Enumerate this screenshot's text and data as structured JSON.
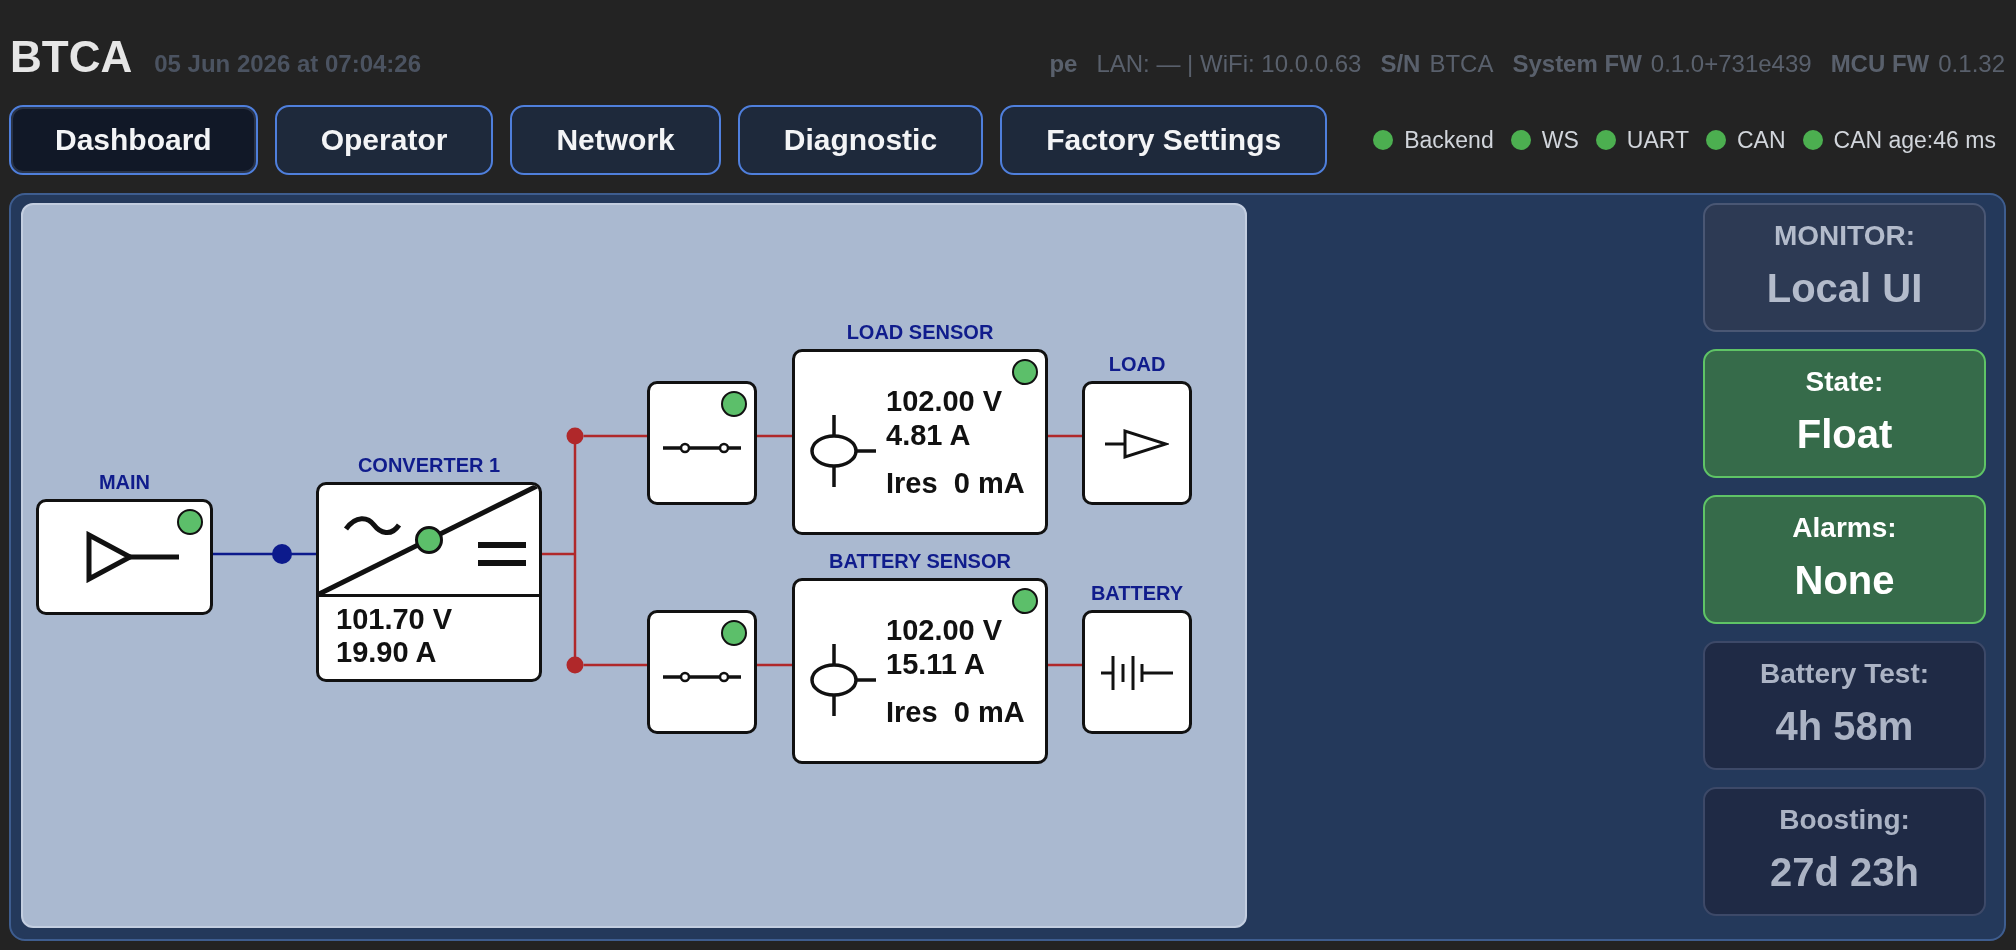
{
  "header": {
    "title": "BTCA",
    "timestamp": "05 Jun 2026 at 07:04:26",
    "info": [
      {
        "label": "pe"
      },
      {
        "value": "LAN: — | WiFi: 10.0.0.63"
      },
      {
        "label": "S/N",
        "value": "BTCA"
      },
      {
        "label": "System FW",
        "value": "0.1.0+731e439"
      },
      {
        "label": "MCU FW",
        "value": "0.1.32"
      }
    ]
  },
  "tabs": [
    {
      "label": "Dashboard",
      "selected": true
    },
    {
      "label": "Operator",
      "selected": false
    },
    {
      "label": "Network",
      "selected": false
    },
    {
      "label": "Diagnostic",
      "selected": false
    },
    {
      "label": "Factory Settings",
      "selected": false
    }
  ],
  "status": [
    {
      "label": "Backend",
      "ok": true
    },
    {
      "label": "WS",
      "ok": true
    },
    {
      "label": "UART",
      "ok": true
    },
    {
      "label": "CAN",
      "ok": true
    },
    {
      "label": "CAN age:46 ms",
      "ok": true
    }
  ],
  "diagram": {
    "main": {
      "label": "MAIN",
      "ok": true
    },
    "converter": {
      "label": "CONVERTER 1",
      "ok": true,
      "voltage": "101.70 V",
      "current": "19.90 A"
    },
    "branches": [
      {
        "breaker": {
          "ok": true
        },
        "sensor": {
          "label": "LOAD SENSOR",
          "ok": true,
          "voltage": "102.00 V",
          "current": "4.81 A",
          "residual": "Ires  0 mA"
        },
        "endpoint": {
          "kind": "load",
          "label": "LOAD"
        }
      },
      {
        "breaker": {
          "ok": true
        },
        "sensor": {
          "label": "BATTERY SENSOR",
          "ok": true,
          "voltage": "102.00 V",
          "current": "15.11 A",
          "residual": "Ires  0 mA"
        },
        "endpoint": {
          "kind": "battery",
          "label": "BATTERY"
        }
      }
    ]
  },
  "cards": [
    {
      "label": "MONITOR:",
      "value": "Local UI",
      "kind": "info"
    },
    {
      "label": "State:",
      "value": "Float",
      "kind": "ok"
    },
    {
      "label": "Alarms:",
      "value": "None",
      "kind": "ok"
    },
    {
      "label": "Battery Test:",
      "value": "4h 58m",
      "kind": "timer"
    },
    {
      "label": "Boosting:",
      "value": "27d 23h",
      "kind": "timer"
    }
  ]
}
